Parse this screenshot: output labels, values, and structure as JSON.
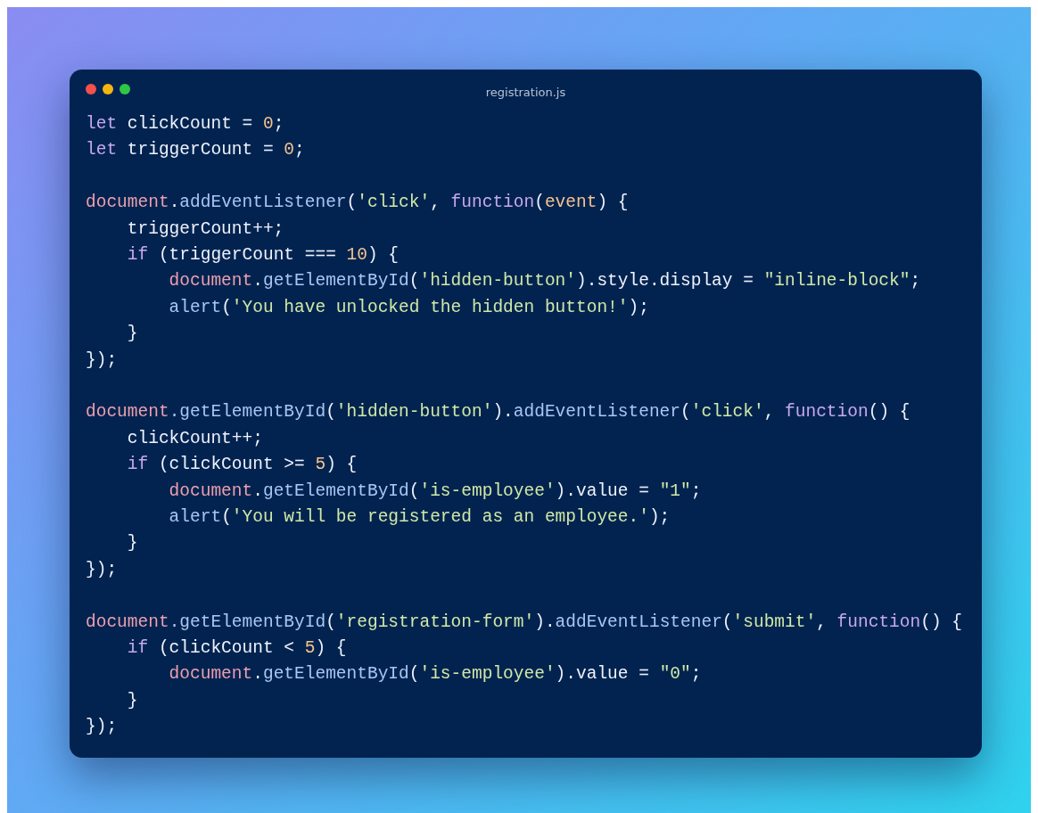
{
  "window": {
    "title": "registration.js"
  },
  "code_blocks": [
    [
      {
        "tokens": [
          {
            "kind": "kw",
            "text": "let"
          },
          {
            "kind": "pl",
            "text": " clickCount = "
          },
          {
            "kind": "num",
            "text": "0"
          },
          {
            "kind": "pl",
            "text": ";"
          }
        ]
      },
      {
        "tokens": [
          {
            "kind": "kw",
            "text": "let"
          },
          {
            "kind": "pl",
            "text": " triggerCount = "
          },
          {
            "kind": "num",
            "text": "0"
          },
          {
            "kind": "pl",
            "text": ";"
          }
        ]
      }
    ],
    [
      {
        "tokens": [
          {
            "kind": "obj",
            "text": "document"
          },
          {
            "kind": "pl",
            "text": "."
          },
          {
            "kind": "fn",
            "text": "addEventListener"
          },
          {
            "kind": "pl",
            "text": "("
          },
          {
            "kind": "str",
            "text": "'click'"
          },
          {
            "kind": "pl",
            "text": ", "
          },
          {
            "kind": "kw",
            "text": "function"
          },
          {
            "kind": "pl",
            "text": "("
          },
          {
            "kind": "param",
            "text": "event"
          },
          {
            "kind": "pl",
            "text": ") {"
          }
        ],
        "children": [
          {
            "tokens": [
              {
                "kind": "pl",
                "text": "triggerCount++;"
              }
            ]
          },
          {
            "tokens": [
              {
                "kind": "kw",
                "text": "if"
              },
              {
                "kind": "pl",
                "text": " (triggerCount === "
              },
              {
                "kind": "num",
                "text": "10"
              },
              {
                "kind": "pl",
                "text": ") {"
              }
            ],
            "children": [
              {
                "tokens": [
                  {
                    "kind": "obj",
                    "text": "document"
                  },
                  {
                    "kind": "pl",
                    "text": "."
                  },
                  {
                    "kind": "fn",
                    "text": "getElementById"
                  },
                  {
                    "kind": "pl",
                    "text": "("
                  },
                  {
                    "kind": "str",
                    "text": "'hidden-button'"
                  },
                  {
                    "kind": "pl",
                    "text": ").style.display = "
                  },
                  {
                    "kind": "str",
                    "text": "\"inline-block\""
                  },
                  {
                    "kind": "pl",
                    "text": ";"
                  }
                ]
              },
              {
                "tokens": [
                  {
                    "kind": "fn",
                    "text": "alert"
                  },
                  {
                    "kind": "pl",
                    "text": "("
                  },
                  {
                    "kind": "str",
                    "text": "'You have unlocked the hidden button!'"
                  },
                  {
                    "kind": "pl",
                    "text": ");"
                  }
                ]
              }
            ]
          },
          {
            "tokens": [
              {
                "kind": "pl",
                "text": "}"
              }
            ]
          }
        ]
      },
      {
        "tokens": [
          {
            "kind": "pl",
            "text": "});"
          }
        ]
      }
    ],
    [
      {
        "tokens": [
          {
            "kind": "obj",
            "text": "document"
          },
          {
            "kind": "fn",
            "text": ".getElementById"
          },
          {
            "kind": "pl",
            "text": "("
          },
          {
            "kind": "str",
            "text": "'hidden-button'"
          },
          {
            "kind": "pl",
            "text": ")."
          },
          {
            "kind": "fn",
            "text": "addEventListener"
          },
          {
            "kind": "pl",
            "text": "("
          },
          {
            "kind": "str",
            "text": "'click'"
          },
          {
            "kind": "pl",
            "text": ", "
          },
          {
            "kind": "kw",
            "text": "function"
          },
          {
            "kind": "pl",
            "text": "() {"
          }
        ],
        "children": [
          {
            "tokens": [
              {
                "kind": "pl",
                "text": "clickCount++;"
              }
            ]
          },
          {
            "tokens": [
              {
                "kind": "kw",
                "text": "if"
              },
              {
                "kind": "pl",
                "text": " (clickCount >= "
              },
              {
                "kind": "num",
                "text": "5"
              },
              {
                "kind": "pl",
                "text": ") {"
              }
            ],
            "children": [
              {
                "tokens": [
                  {
                    "kind": "obj",
                    "text": "document"
                  },
                  {
                    "kind": "pl",
                    "text": "."
                  },
                  {
                    "kind": "fn",
                    "text": "getElementById"
                  },
                  {
                    "kind": "pl",
                    "text": "("
                  },
                  {
                    "kind": "str",
                    "text": "'is-employee'"
                  },
                  {
                    "kind": "pl",
                    "text": ").value = "
                  },
                  {
                    "kind": "str",
                    "text": "\"1\""
                  },
                  {
                    "kind": "pl",
                    "text": ";"
                  }
                ]
              },
              {
                "tokens": [
                  {
                    "kind": "fn",
                    "text": "alert"
                  },
                  {
                    "kind": "pl",
                    "text": "("
                  },
                  {
                    "kind": "str",
                    "text": "'You will be registered as an employee.'"
                  },
                  {
                    "kind": "pl",
                    "text": ");"
                  }
                ]
              }
            ]
          },
          {
            "tokens": [
              {
                "kind": "pl",
                "text": "}"
              }
            ]
          }
        ]
      },
      {
        "tokens": [
          {
            "kind": "pl",
            "text": "});"
          }
        ]
      }
    ],
    [
      {
        "tokens": [
          {
            "kind": "obj",
            "text": "document"
          },
          {
            "kind": "fn",
            "text": ".getElementById"
          },
          {
            "kind": "pl",
            "text": "("
          },
          {
            "kind": "str",
            "text": "'registration-form'"
          },
          {
            "kind": "pl",
            "text": ")."
          },
          {
            "kind": "fn",
            "text": "addEventListener"
          },
          {
            "kind": "pl",
            "text": "("
          },
          {
            "kind": "str",
            "text": "'submit'"
          },
          {
            "kind": "pl",
            "text": ", "
          },
          {
            "kind": "kw",
            "text": "function"
          },
          {
            "kind": "pl",
            "text": "() {"
          }
        ],
        "children": [
          {
            "tokens": [
              {
                "kind": "kw",
                "text": "if"
              },
              {
                "kind": "pl",
                "text": " (clickCount < "
              },
              {
                "kind": "num",
                "text": "5"
              },
              {
                "kind": "pl",
                "text": ") {"
              }
            ],
            "children": [
              {
                "tokens": [
                  {
                    "kind": "obj",
                    "text": "document"
                  },
                  {
                    "kind": "pl",
                    "text": "."
                  },
                  {
                    "kind": "fn",
                    "text": "getElementById"
                  },
                  {
                    "kind": "pl",
                    "text": "("
                  },
                  {
                    "kind": "str",
                    "text": "'is-employee'"
                  },
                  {
                    "kind": "pl",
                    "text": ").value = "
                  },
                  {
                    "kind": "str",
                    "text": "\"0\""
                  },
                  {
                    "kind": "pl",
                    "text": ";"
                  }
                ]
              }
            ]
          },
          {
            "tokens": [
              {
                "kind": "pl",
                "text": "}"
              }
            ]
          }
        ]
      },
      {
        "tokens": [
          {
            "kind": "pl",
            "text": "});"
          }
        ]
      }
    ]
  ]
}
